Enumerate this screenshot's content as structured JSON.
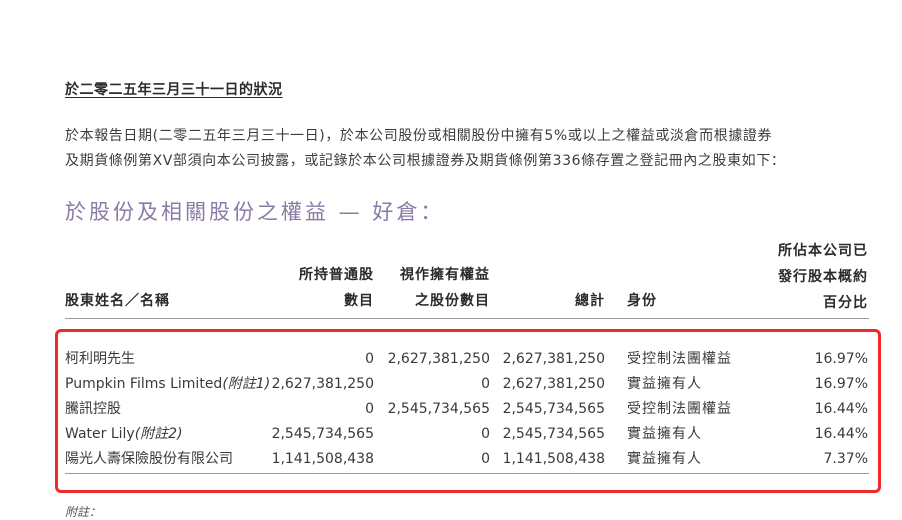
{
  "heading": "於二零二五年三月三十一日的狀況",
  "intro": {
    "line1": "於本報告日期(二零二五年三月三十一日)，於本公司股份或相關股份中擁有5%或以上之權益或淡倉而根據證券",
    "line2": "及期貨條例第XV部須向本公司披露，或記錄於本公司根據證券及期貨條例第336條存置之登記冊內之股東如下："
  },
  "subtitle": "於股份及相關股份之權益 — 好倉：",
  "table": {
    "headers": {
      "name": "股東姓名／名稱",
      "shares": [
        "所持普通股",
        "數目"
      ],
      "deemed": [
        "視作擁有權益",
        "之股份數目"
      ],
      "total": "總計",
      "capacity": "身份",
      "pct": [
        "所佔本公司已",
        "發行股本概約",
        "百分比"
      ]
    },
    "rows": [
      {
        "name": "柯利明先生",
        "note": "",
        "shares": "0",
        "deemed": "2,627,381,250",
        "total": "2,627,381,250",
        "capacity": "受控制法團權益",
        "pct": "16.97%"
      },
      {
        "name": "Pumpkin Films Limited",
        "note": "(附註1)",
        "shares": "2,627,381,250",
        "deemed": "0",
        "total": "2,627,381,250",
        "capacity": "實益擁有人",
        "pct": "16.97%"
      },
      {
        "name": "騰訊控股",
        "note": "",
        "shares": "0",
        "deemed": "2,545,734,565",
        "total": "2,545,734,565",
        "capacity": "受控制法團權益",
        "pct": "16.44%"
      },
      {
        "name": "Water Lily",
        "note": "(附註2)",
        "shares": "2,545,734,565",
        "deemed": "0",
        "total": "2,545,734,565",
        "capacity": "實益擁有人",
        "pct": "16.44%"
      },
      {
        "name": "陽光人壽保險股份有限公司",
        "note": "",
        "shares": "1,141,508,438",
        "deemed": "0",
        "total": "1,141,508,438",
        "capacity": "實益擁有人",
        "pct": "7.37%"
      }
    ]
  },
  "footnote": "附註：",
  "colors": {
    "subtitle": "#8a7aa6",
    "highlight_box": "#ee2b2b"
  }
}
